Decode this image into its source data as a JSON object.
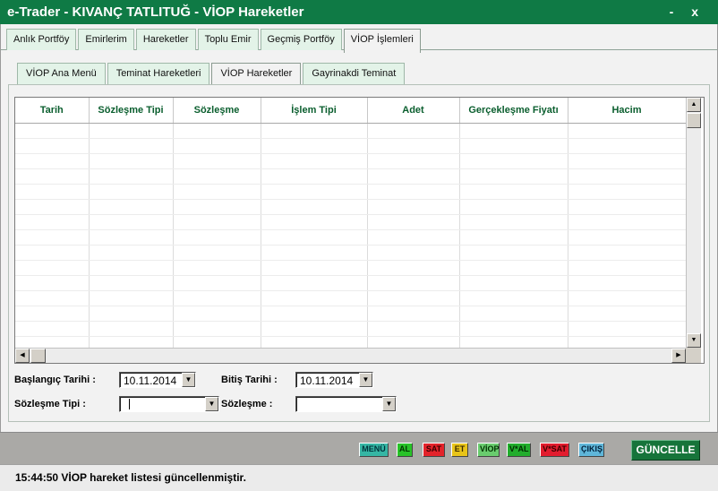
{
  "window": {
    "title": "e-Trader - KIVANÇ TATLITUĞ - VİOP Hareketler",
    "controls": "- x"
  },
  "main_tabs": [
    {
      "label": "Anlık Portföy"
    },
    {
      "label": "Emirlerim"
    },
    {
      "label": "Hareketler"
    },
    {
      "label": "Toplu Emir"
    },
    {
      "label": "Geçmiş Portföy"
    },
    {
      "label": "VİOP İşlemleri",
      "active": true
    }
  ],
  "sub_tabs": [
    {
      "label": "VİOP Ana Menü"
    },
    {
      "label": "Teminat Hareketleri"
    },
    {
      "label": "VİOP Hareketler",
      "active": true
    },
    {
      "label": "Gayrinakdi Teminat"
    }
  ],
  "table": {
    "columns": [
      "Tarih",
      "Sözleşme Tipi",
      "Sözleşme",
      "İşlem Tipi",
      "Adet",
      "Gerçekleşme Fiyatı",
      "Hacim"
    ],
    "rows": []
  },
  "filters": {
    "start_date_label": "Başlangıç Tarihi :",
    "start_date_value": "10.11.2014",
    "end_date_label": "Bitiş Tarihi :",
    "end_date_value": "10.11.2014",
    "contract_type_label": "Sözleşme Tipi :",
    "contract_type_value": "",
    "contract_label": "Sözleşme :",
    "contract_value": ""
  },
  "toolbar": {
    "buttons": [
      {
        "label": "MENÜ",
        "color": "#35b6a4",
        "text_color": "#00333a"
      },
      {
        "label": "AL",
        "color": "#28c228",
        "text_color": "#003300"
      },
      {
        "label": "SAT",
        "color": "#e3232a",
        "text_color": "#3a0000"
      },
      {
        "label": "ET",
        "color": "#e8c419",
        "text_color": "#3a2a00"
      },
      {
        "label": "VİOP",
        "color": "#69cc6e",
        "text_color": "#003300"
      },
      {
        "label": "V*AL",
        "color": "#22ad2c",
        "text_color": "#002a00"
      },
      {
        "label": "V*SAT",
        "color": "#e21c2e",
        "text_color": "#3a0000"
      },
      {
        "label": "ÇIKIŞ",
        "color": "#5fb6d9",
        "text_color": "#00203a"
      }
    ],
    "update_label": "GÜNCELLE"
  },
  "status_bar": {
    "message": "15:44:50 VİOP hareket listesi güncellenmiştir."
  }
}
